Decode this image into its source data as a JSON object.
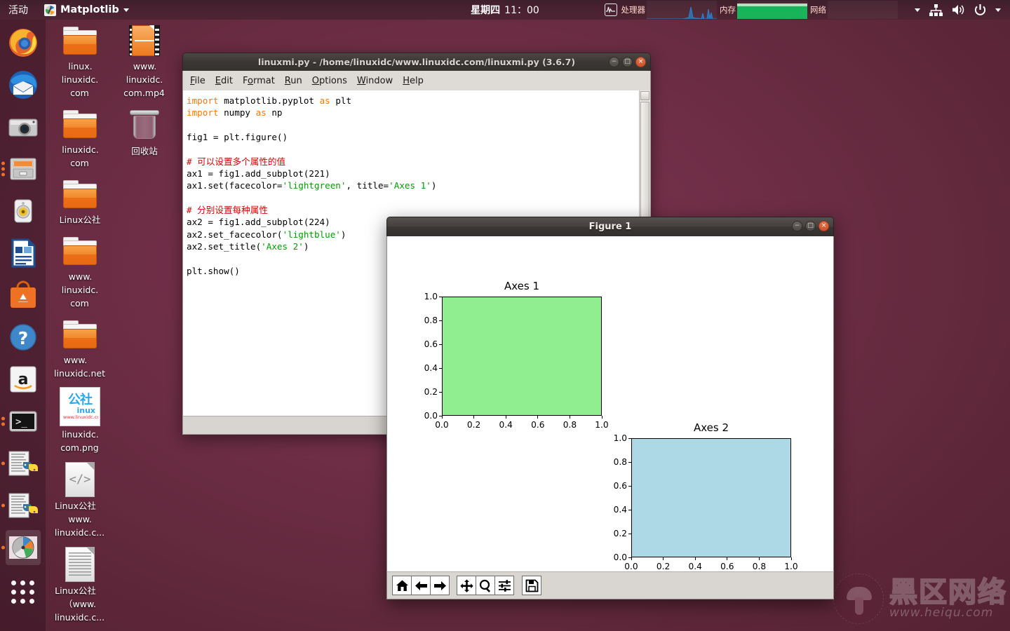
{
  "top_panel": {
    "activities": "活动",
    "app_name": "Matplotlib",
    "clock_day": "星期四",
    "clock_time": "11：00",
    "cpu_label": "处理器",
    "mem_label": "内存",
    "net_label": "网络",
    "accent_color": "#e8732a",
    "panel_color": "#50243a",
    "mem_fill_color": "#19b35a"
  },
  "launcher": {
    "items": [
      {
        "name": "firefox",
        "label": "Firefox"
      },
      {
        "name": "thunderbird",
        "label": "Thunderbird"
      },
      {
        "name": "camera",
        "label": "Camera"
      },
      {
        "name": "files",
        "label": "Files"
      },
      {
        "name": "rhythmbox",
        "label": "Rhythmbox"
      },
      {
        "name": "libreoffice-writer",
        "label": "LibreOffice Writer"
      },
      {
        "name": "ubuntu-software",
        "label": "Ubuntu Software"
      },
      {
        "name": "help",
        "label": "Help"
      },
      {
        "name": "amazon",
        "label": "Amazon"
      },
      {
        "name": "terminal",
        "label": "Terminal"
      },
      {
        "name": "idle-editor",
        "label": "IDLE"
      },
      {
        "name": "idle-shell",
        "label": "IDLE Shell"
      },
      {
        "name": "matplotlib-figure",
        "label": "Matplotlib"
      },
      {
        "name": "show-applications",
        "label": "Show Applications"
      }
    ]
  },
  "desktop_icons": [
    {
      "type": "folder",
      "label": "linux.\nlinuxidc.\ncom"
    },
    {
      "type": "mp4",
      "label": "www.\nlinuxidc.\ncom.mp4"
    },
    {
      "type": "folder",
      "label": "linuxidc.\ncom"
    },
    {
      "type": "trash",
      "label": "回收站"
    },
    {
      "type": "folder",
      "label": "Linux公社"
    },
    {
      "type": "folder",
      "label": "www.\nlinuxidc.\ncom"
    },
    {
      "type": "folder",
      "label": "www.\nlinuxidc.net"
    },
    {
      "type": "png",
      "label": "linuxidc.\ncom.png"
    },
    {
      "type": "code",
      "label": "Linux公社\nwww.\nlinuxidc.c..."
    },
    {
      "type": "text",
      "label": "Linux公社\n（www.\nlinuxidc.c..."
    }
  ],
  "png_icon": {
    "cn_text": "公社",
    "sub_text": "inux",
    "url_text": "www.linuxidc.com"
  },
  "idle_window": {
    "title": "linuxmi.py - /home/linuxidc/www.linuxidc.com/linuxmi.py (3.6.7)",
    "menus": [
      "File",
      "Edit",
      "Format",
      "Run",
      "Options",
      "Window",
      "Help"
    ],
    "minimize_glyph": "−",
    "maximize_glyph": "□",
    "close_glyph": "×",
    "code_lines": [
      {
        "segments": [
          {
            "t": "import",
            "c": "kw"
          },
          {
            "t": " matplotlib.pyplot ",
            "c": ""
          },
          {
            "t": "as",
            "c": "kw"
          },
          {
            "t": " plt",
            "c": ""
          }
        ]
      },
      {
        "segments": [
          {
            "t": "import",
            "c": "kw"
          },
          {
            "t": " numpy ",
            "c": ""
          },
          {
            "t": "as",
            "c": "kw"
          },
          {
            "t": " np",
            "c": ""
          }
        ]
      },
      {
        "segments": [
          {
            "t": "",
            "c": ""
          }
        ]
      },
      {
        "segments": [
          {
            "t": "fig1 = plt.figure()",
            "c": ""
          }
        ]
      },
      {
        "segments": [
          {
            "t": "",
            "c": ""
          }
        ]
      },
      {
        "segments": [
          {
            "t": "# 可以设置多个属性的值",
            "c": "cmt"
          }
        ]
      },
      {
        "segments": [
          {
            "t": "ax1 = fig1.add_subplot(221)",
            "c": ""
          }
        ]
      },
      {
        "segments": [
          {
            "t": "ax1.set(facecolor=",
            "c": ""
          },
          {
            "t": "'lightgreen'",
            "c": "str"
          },
          {
            "t": ", title=",
            "c": ""
          },
          {
            "t": "'Axes 1'",
            "c": "str"
          },
          {
            "t": ")",
            "c": ""
          }
        ]
      },
      {
        "segments": [
          {
            "t": "",
            "c": ""
          }
        ]
      },
      {
        "segments": [
          {
            "t": "# 分别设置每种属性",
            "c": "cmt"
          }
        ]
      },
      {
        "segments": [
          {
            "t": "ax2 = fig1.add_subplot(224)",
            "c": ""
          }
        ]
      },
      {
        "segments": [
          {
            "t": "ax2.set_facecolor(",
            "c": ""
          },
          {
            "t": "'lightblue'",
            "c": "str"
          },
          {
            "t": ")",
            "c": ""
          }
        ]
      },
      {
        "segments": [
          {
            "t": "ax2.set_title(",
            "c": ""
          },
          {
            "t": "'Axes 2'",
            "c": "str"
          },
          {
            "t": ")",
            "c": ""
          }
        ]
      },
      {
        "segments": [
          {
            "t": "",
            "c": ""
          }
        ]
      },
      {
        "segments": [
          {
            "t": "plt.show()",
            "c": ""
          }
        ]
      }
    ]
  },
  "figure_window": {
    "title": "Figure 1",
    "minimize_glyph": "−",
    "maximize_glyph": "□",
    "close_glyph": "×",
    "toolbar": [
      {
        "name": "home-button",
        "label": "Home"
      },
      {
        "name": "back-button",
        "label": "Back"
      },
      {
        "name": "forward-button",
        "label": "Forward"
      },
      {
        "name": "pan-button",
        "label": "Pan"
      },
      {
        "name": "zoom-button",
        "label": "Zoom to rectangle"
      },
      {
        "name": "configure-subplots-button",
        "label": "Configure subplots"
      },
      {
        "name": "save-button",
        "label": "Save figure"
      }
    ]
  },
  "chart_data": [
    {
      "type": "area",
      "title": "Axes 1",
      "subplot": "221",
      "facecolor": "#90ee90",
      "facecolor_name": "lightgreen",
      "xlabel": "",
      "ylabel": "",
      "xlim": [
        0.0,
        1.0
      ],
      "ylim": [
        0.0,
        1.0
      ],
      "xticks": [
        "0.0",
        "0.2",
        "0.4",
        "0.6",
        "0.8",
        "1.0"
      ],
      "yticks": [
        "0.0",
        "0.2",
        "0.4",
        "0.6",
        "0.8",
        "1.0"
      ],
      "xtick_values": [
        0.0,
        0.2,
        0.4,
        0.6,
        0.8,
        1.0
      ],
      "ytick_values": [
        0.0,
        0.2,
        0.4,
        0.6,
        0.8,
        1.0
      ],
      "series": [],
      "grid": false,
      "legend": null
    },
    {
      "type": "area",
      "title": "Axes 2",
      "subplot": "224",
      "facecolor": "#add8e6",
      "facecolor_name": "lightblue",
      "xlabel": "",
      "ylabel": "",
      "xlim": [
        0.0,
        1.0
      ],
      "ylim": [
        0.0,
        1.0
      ],
      "xticks": [
        "0.0",
        "0.2",
        "0.4",
        "0.6",
        "0.8",
        "1.0"
      ],
      "yticks": [
        "0.0",
        "0.2",
        "0.4",
        "0.6",
        "0.8",
        "1.0"
      ],
      "xtick_values": [
        0.0,
        0.2,
        0.4,
        0.6,
        0.8,
        1.0
      ],
      "ytick_values": [
        0.0,
        0.2,
        0.4,
        0.6,
        0.8,
        1.0
      ],
      "series": [],
      "grid": false,
      "legend": null
    }
  ],
  "watermark": {
    "cn": "黑区网络",
    "url": "www.heiqu.com"
  }
}
